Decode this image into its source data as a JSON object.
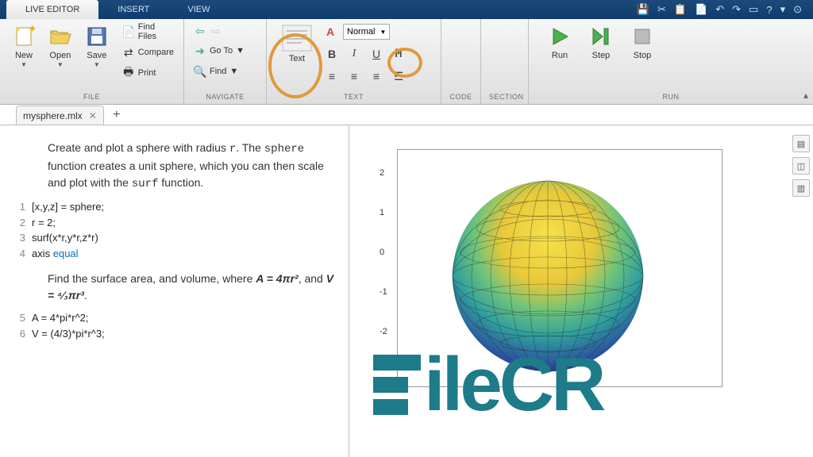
{
  "tabs": {
    "live_editor": "LIVE EDITOR",
    "insert": "INSERT",
    "view": "VIEW"
  },
  "ribbon": {
    "file": {
      "label": "FILE",
      "new": "New",
      "open": "Open",
      "save": "Save",
      "find_files": "Find Files",
      "compare": "Compare",
      "print": "Print"
    },
    "navigate": {
      "label": "NAVIGATE",
      "goto": "Go To",
      "find": "Find"
    },
    "text": {
      "label": "TEXT",
      "text_btn": "Text",
      "style": "Normal",
      "bold": "B",
      "italic": "I",
      "underline": "U",
      "mono": "M"
    },
    "code": {
      "label": "CODE"
    },
    "section": {
      "label": "SECTION"
    },
    "run": {
      "label": "RUN",
      "run": "Run",
      "step": "Step",
      "stop": "Stop"
    }
  },
  "doc": {
    "tab_name": "mysphere.mlx",
    "close": "✕",
    "add": "+"
  },
  "editor": {
    "para1_a": "Create and plot a sphere with radius ",
    "para1_r": "r",
    "para1_b": ". The ",
    "para1_sphere": "sphere",
    "para1_c": " function creates a unit sphere, which you can then scale and plot with the ",
    "para1_surf": "surf",
    "para1_d": " function.",
    "code1": {
      "l1": "[x,y,z] = sphere;",
      "l2": "r = 2;",
      "l3": "surf(x*r,y*r,z*r)",
      "l4a": "axis ",
      "l4b": "equal",
      "n1": "1",
      "n2": "2",
      "n3": "3",
      "n4": "4"
    },
    "para2_a": "Find the surface area, and volume, where ",
    "para2_b": ", and ",
    "para2_c": ".",
    "formula_A": "A = 4πr²",
    "formula_V": "V = ⁴⁄₃πr³",
    "code2": {
      "l5": "A = 4*pi*r^2;",
      "l6": "V = (4/3)*pi*r^3;",
      "n5": "5",
      "n6": "6"
    }
  },
  "plot": {
    "yticks": [
      "2",
      "1",
      "0",
      "-1",
      "-2"
    ]
  },
  "watermark": "ileCR"
}
